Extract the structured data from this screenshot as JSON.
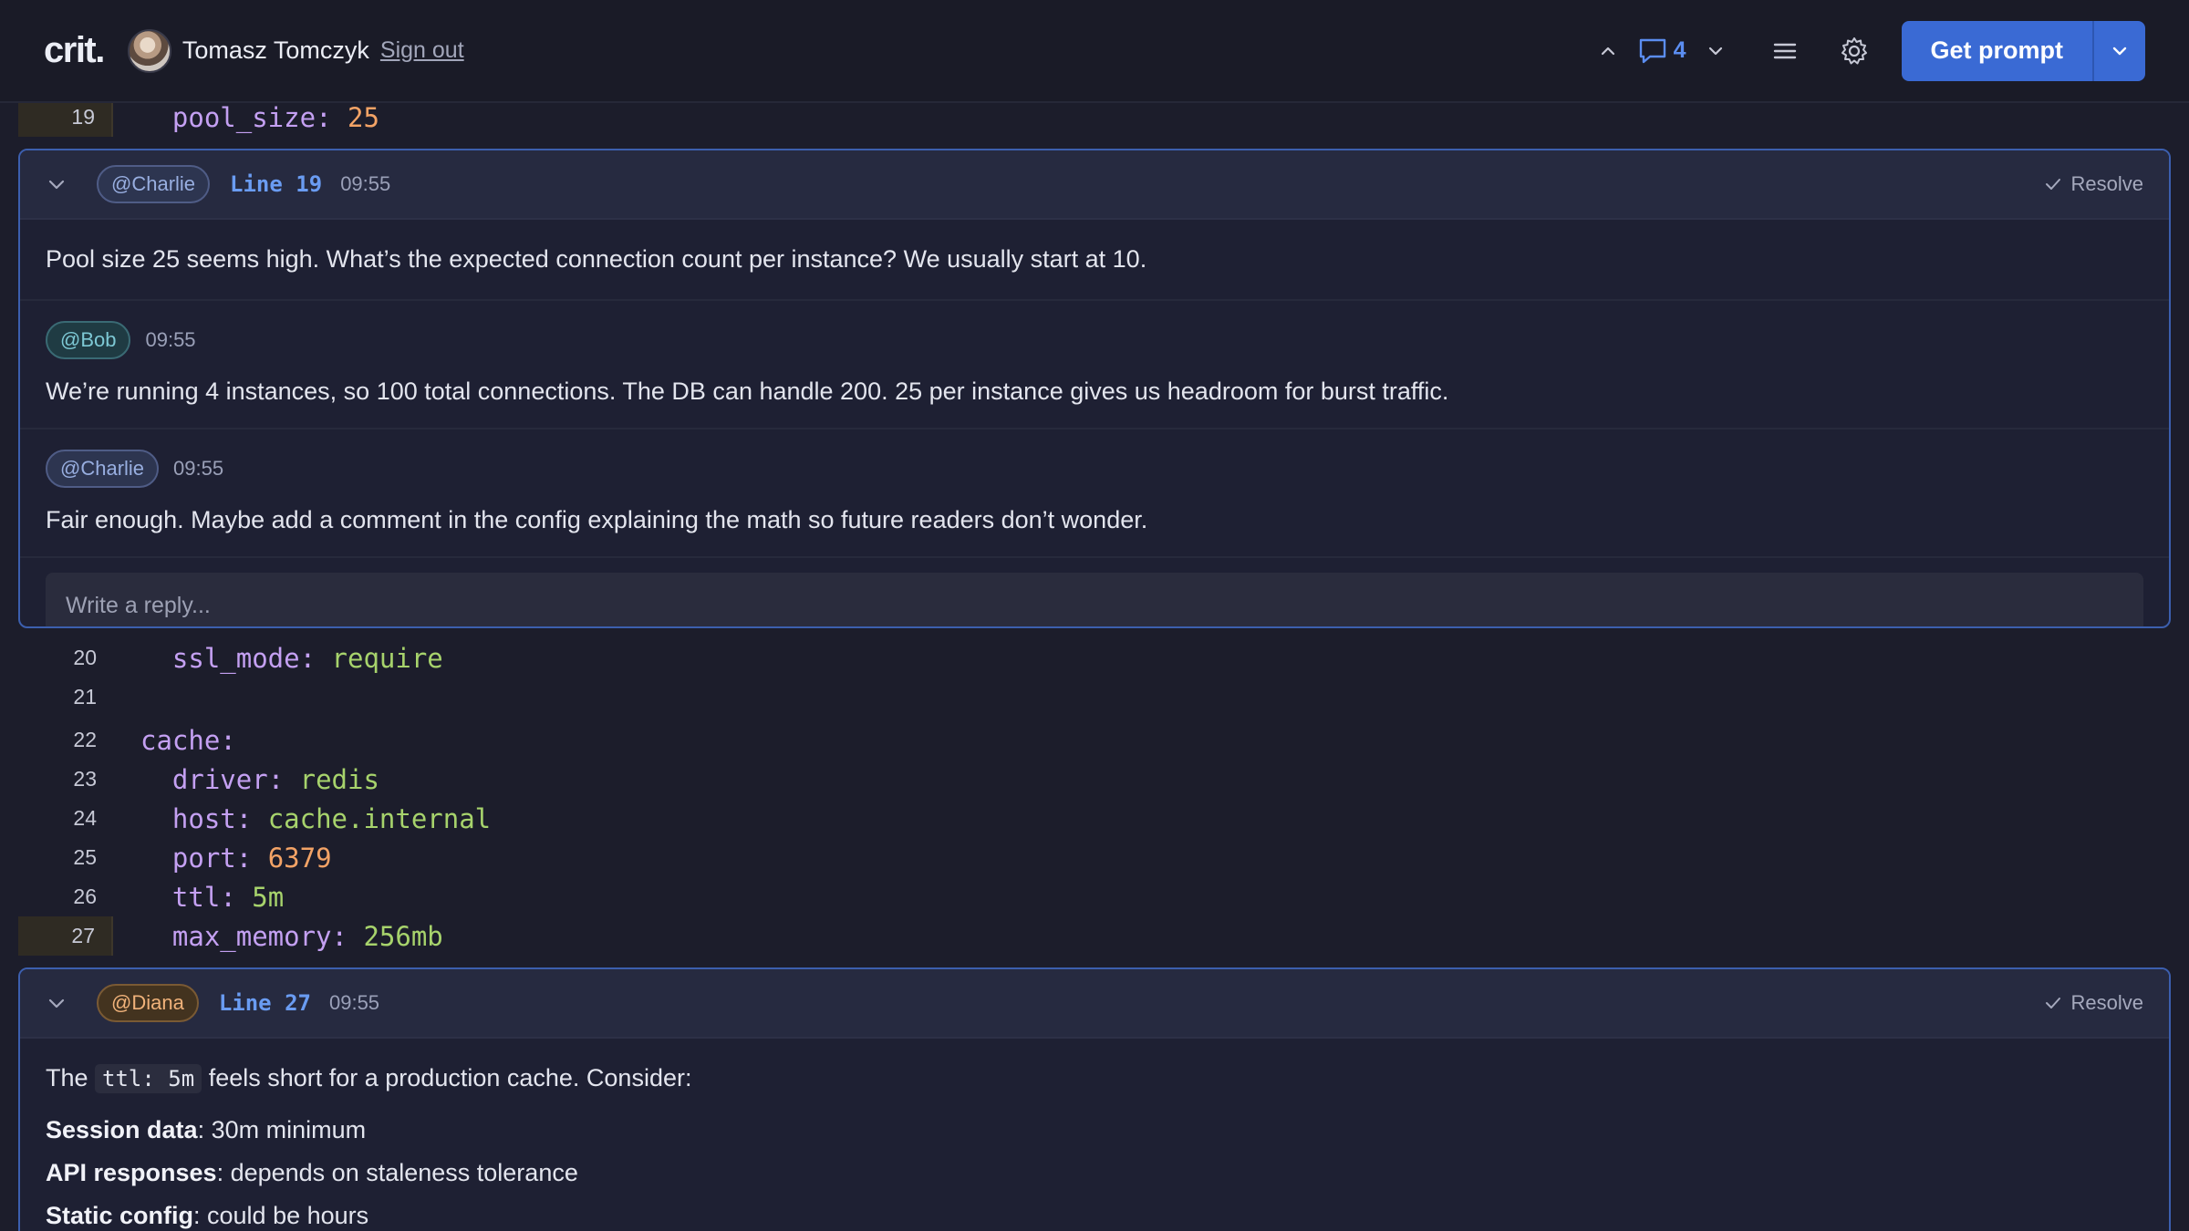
{
  "header": {
    "logo": "crit.",
    "user_name": "Tomasz Tomczyk",
    "sign_out": "Sign out",
    "comment_count": "4",
    "get_prompt": "Get prompt",
    "colors": {
      "primary": "#3a6ad4",
      "background": "#1a1b27"
    }
  },
  "lines": [
    {
      "num": "19",
      "indent": "  ",
      "key": "pool_size",
      "value": "25",
      "value_type": "number",
      "marked": true
    },
    {
      "num": "20",
      "indent": "  ",
      "key": "ssl_mode",
      "value": "require",
      "value_type": "string",
      "marked": false
    },
    {
      "num": "21",
      "indent": "",
      "key": "",
      "value": "",
      "value_type": "none",
      "marked": false
    },
    {
      "num": "22",
      "indent": "",
      "key": "cache",
      "value": "",
      "value_type": "none",
      "marked": false
    },
    {
      "num": "23",
      "indent": "  ",
      "key": "driver",
      "value": "redis",
      "value_type": "string",
      "marked": false
    },
    {
      "num": "24",
      "indent": "  ",
      "key": "host",
      "value": "cache.internal",
      "value_type": "string",
      "marked": false
    },
    {
      "num": "25",
      "indent": "  ",
      "key": "port",
      "value": "6379",
      "value_type": "number",
      "marked": false
    },
    {
      "num": "26",
      "indent": "  ",
      "key": "ttl",
      "value": "5m",
      "value_type": "string",
      "marked": false
    },
    {
      "num": "27",
      "indent": "  ",
      "key": "max_memory",
      "value": "256mb",
      "value_type": "string",
      "marked": true
    }
  ],
  "thread1": {
    "author": "@Charlie",
    "line_ref": "Line 19",
    "time": "09:55",
    "resolve": "Resolve",
    "body": "Pool size 25 seems high. What’s the expected connection count per instance? We usually start at 10.",
    "replies": [
      {
        "author": "@Bob",
        "time": "09:55",
        "text": "We’re running 4 instances, so 100 total connections. The DB can handle 200. 25 per instance gives us headroom for burst traffic."
      },
      {
        "author": "@Charlie",
        "time": "09:55",
        "text": "Fair enough. Maybe add a comment in the config explaining the math so future readers don’t wonder."
      }
    ],
    "reply_placeholder": "Write a reply..."
  },
  "thread2": {
    "author": "@Diana",
    "line_ref": "Line 27",
    "time": "09:55",
    "resolve": "Resolve",
    "intro_before": "The ",
    "intro_code": "ttl: 5m",
    "intro_after": " feels short for a production cache. Consider:",
    "bullets": [
      {
        "label": "Session data",
        "text": ": 30m minimum"
      },
      {
        "label": "API responses",
        "text": ": depends on staleness tolerance"
      },
      {
        "label": "Static config",
        "text": ": could be hours"
      }
    ]
  }
}
